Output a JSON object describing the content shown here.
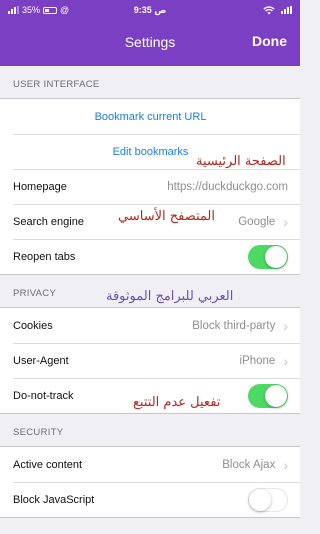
{
  "status": {
    "battery": "35%",
    "time": "9:35 ص"
  },
  "nav": {
    "title": "Settings",
    "done": "Done"
  },
  "sections": {
    "ui": "USER INTERFACE",
    "privacy": "PRIVACY",
    "security": "SECURITY"
  },
  "rows": {
    "bookmark_current": "Bookmark current URL",
    "edit_bookmarks": "Edit bookmarks",
    "homepage": {
      "label": "Homepage",
      "value": "https://duckduckgo.com"
    },
    "search_engine": {
      "label": "Search engine",
      "value": "Google"
    },
    "reopen_tabs": {
      "label": "Reopen tabs",
      "on": true
    },
    "cookies": {
      "label": "Cookies",
      "value": "Block third-party"
    },
    "user_agent": {
      "label": "User-Agent",
      "value": "iPhone"
    },
    "do_not_track": {
      "label": "Do-not-track",
      "on": true
    },
    "active_content": {
      "label": "Active content",
      "value": "Block Ajax"
    },
    "block_js": {
      "label": "Block JavaScript",
      "on": false
    }
  },
  "overlays": {
    "homepage": "الصفحة الرئيسية",
    "search_engine": "المتصفح الأساسي",
    "watermark": "العربي للبرامج الموثوقة",
    "dnt": "تفعيل عدم التتبع"
  },
  "colors": {
    "accent": "#7b3fc4",
    "link": "#1a7ee6",
    "toggle_on": "#4cd964"
  }
}
